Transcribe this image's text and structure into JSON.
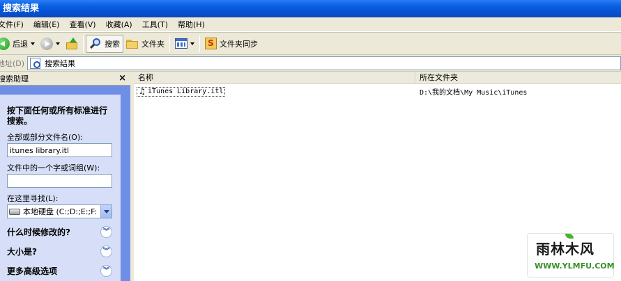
{
  "window": {
    "title": "搜索结果"
  },
  "menu": [
    "文件(F)",
    "编辑(E)",
    "查看(V)",
    "收藏(A)",
    "工具(T)",
    "帮助(H)"
  ],
  "toolbar": {
    "back_label": "后退",
    "search_label": "搜索",
    "folders_label": "文件夹",
    "sync_label": "文件夹同步"
  },
  "address": {
    "label": "地址(D)",
    "value": "搜索结果"
  },
  "search_pane": {
    "title": "搜索助理",
    "close": "×",
    "intro": "按下面任何或所有标准进行搜索。",
    "filename_label": "全部或部分文件名(O):",
    "filename_value": "itunes library.itl",
    "phrase_label": "文件中的一个字或词组(W):",
    "phrase_value": "",
    "lookin_label": "在这里寻找(L):",
    "lookin_value": "本地硬盘 (C:;D:;E:;F:",
    "options": [
      "什么时候修改的?",
      "大小是?",
      "更多高级选项"
    ]
  },
  "results": {
    "columns": [
      "名称",
      "所在文件夹"
    ],
    "rows": [
      {
        "name": "iTunes Library.itl",
        "folder": "D:\\我的文档\\My Music\\iTunes"
      }
    ]
  },
  "watermark": {
    "logo": "雨林木风",
    "url": "WWW.YLMFU.COM"
  },
  "colors": {
    "titlebar": "#0a5fe0",
    "chrome": "#ece9d8",
    "pane_bg": "#6f8ee6",
    "pane_body": "#d6dff7"
  },
  "icons": {
    "back": "back-arrow-icon",
    "forward": "forward-arrow-icon",
    "up": "up-folder-icon",
    "search": "search-icon",
    "folders": "folder-icon",
    "views": "views-icon",
    "sync": "folder-sync-icon",
    "file": "music-note-icon"
  }
}
